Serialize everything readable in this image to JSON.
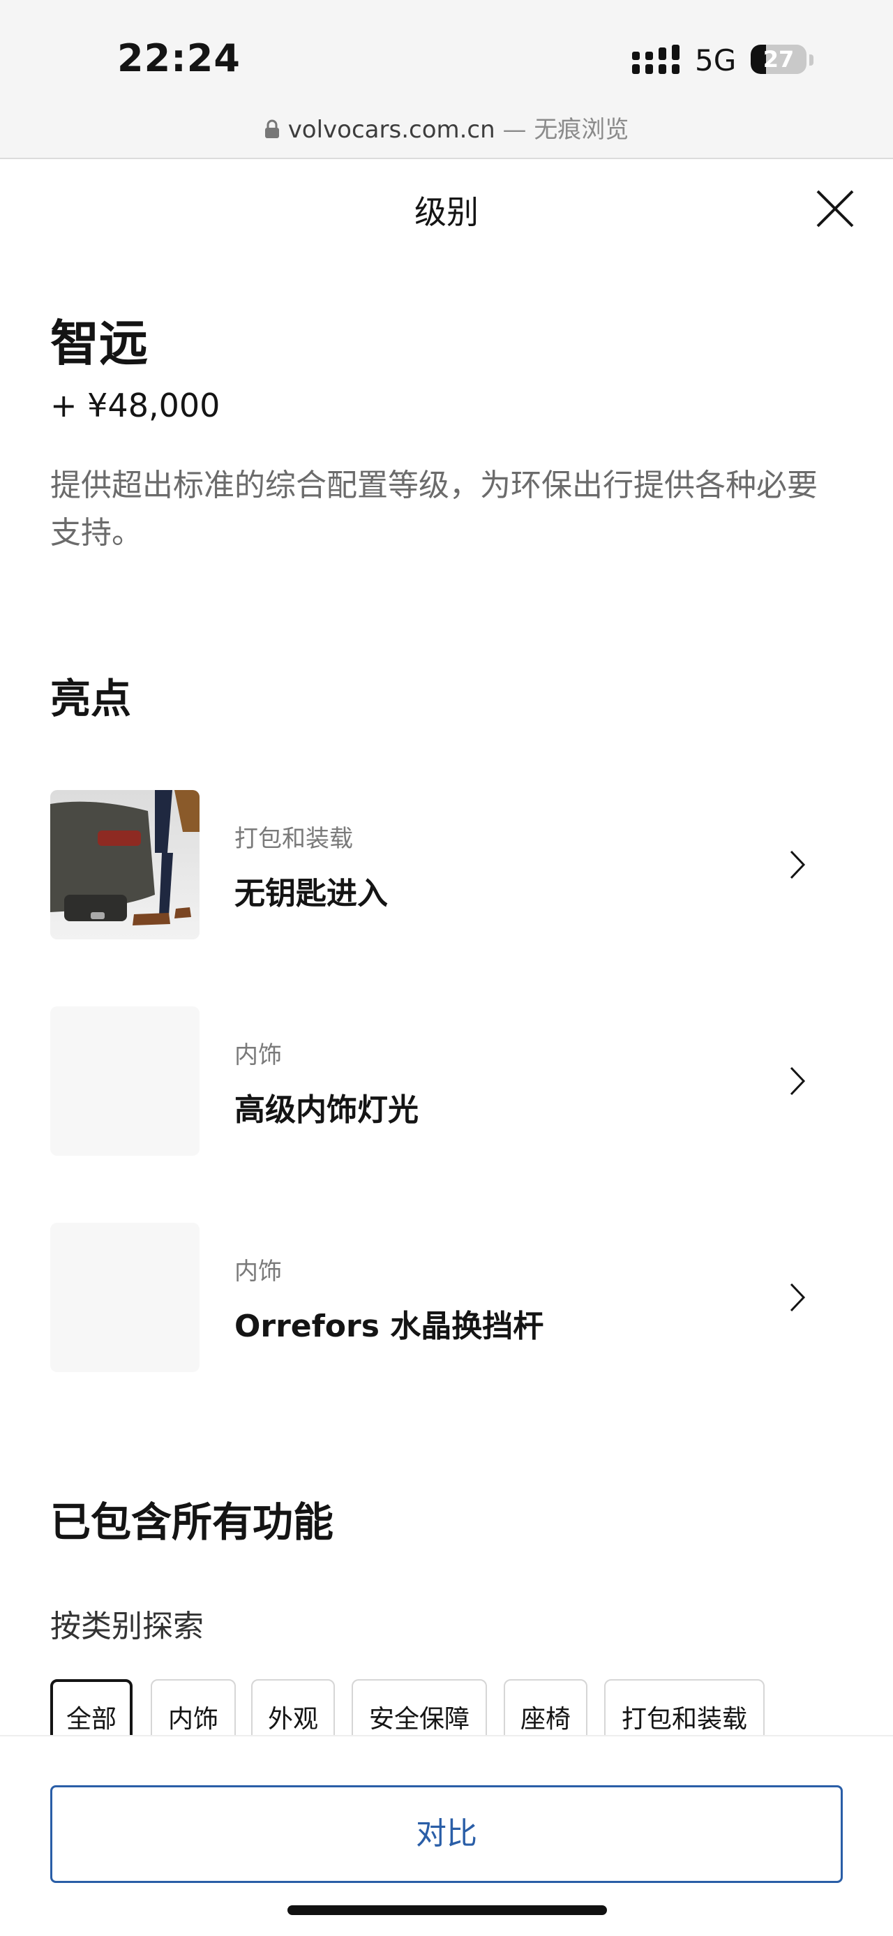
{
  "status_bar": {
    "time": "22:24",
    "network": "5G",
    "battery": "27",
    "battery_level": 0.27,
    "icons": [
      "signal-bars-icon",
      "battery-icon"
    ]
  },
  "address_bar": {
    "host": "volvocars.com.cn",
    "separator": " — ",
    "mode": "无痕浏览",
    "icon": "lock-icon"
  },
  "modal": {
    "title": "级别",
    "close_icon": "close-icon"
  },
  "trim": {
    "name": "智远",
    "price": "+ ¥48,000",
    "description": "提供超出标准的综合配置等级，为环保出行提供各种必要支持。"
  },
  "highlights": {
    "title": "亮点",
    "items": [
      {
        "category": "打包和装载",
        "name": "无钥匙进入",
        "icon": "chevron-right-icon"
      },
      {
        "category": "内饰",
        "name": "高级内饰灯光",
        "icon": "chevron-right-icon"
      },
      {
        "category": "内饰",
        "name": "Orrefors 水晶换挡杆",
        "icon": "chevron-right-icon"
      }
    ]
  },
  "features": {
    "title": "已包含所有功能",
    "explore_label": "按类别探索",
    "categories": [
      "全部",
      "内饰",
      "外观",
      "安全保障",
      "座椅",
      "打包和装载"
    ],
    "active_category": "全部"
  },
  "footer": {
    "compare_label": "对比"
  },
  "colors": {
    "accent": "#2a5ea7",
    "text": "#141414",
    "muted": "#6b6b6b"
  }
}
